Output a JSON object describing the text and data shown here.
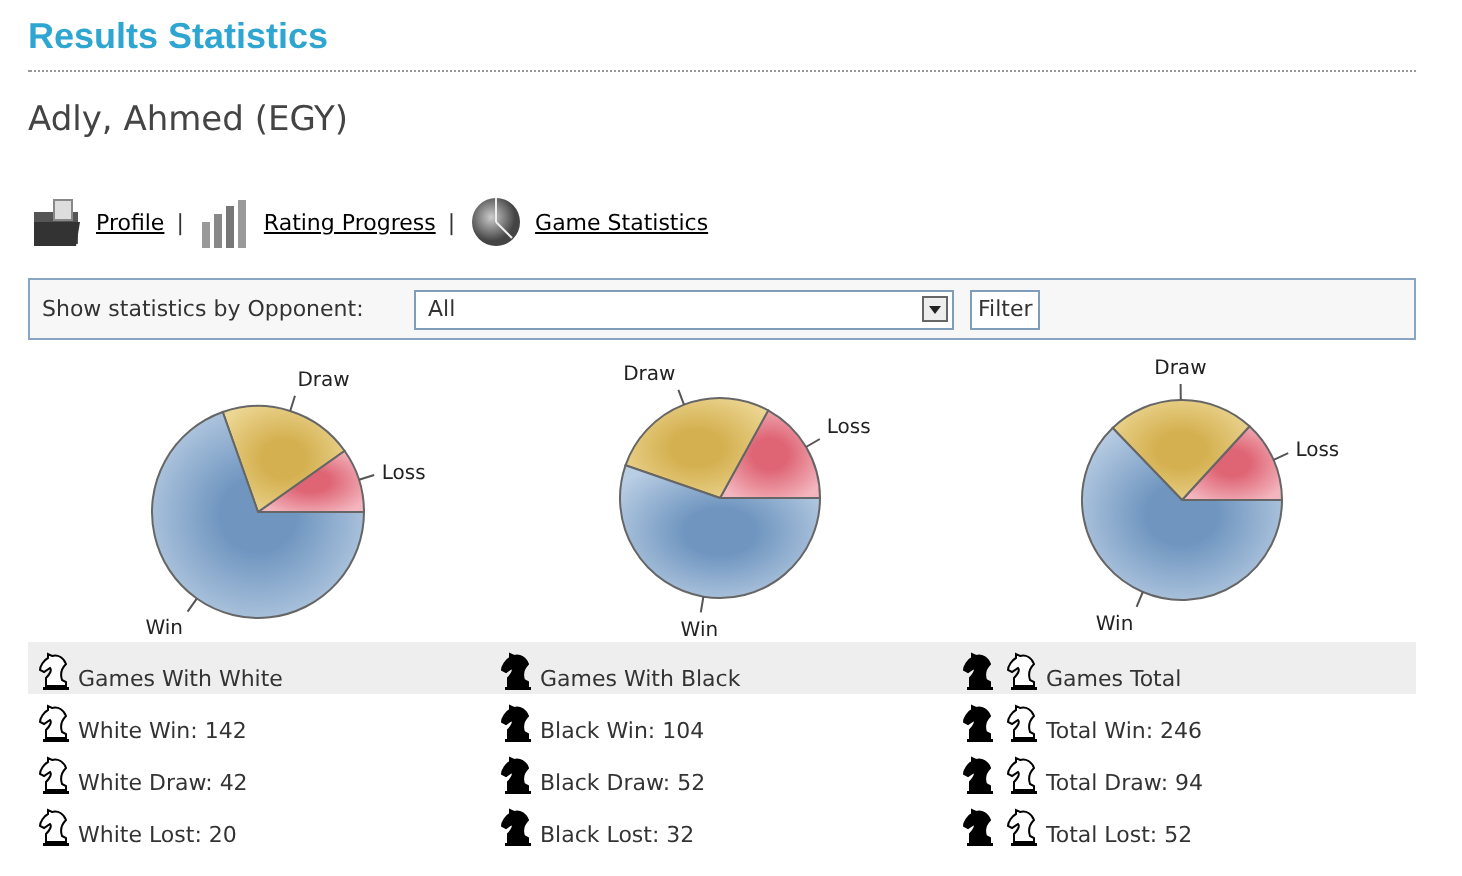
{
  "page_title": "Results Statistics",
  "player": "Adly, Ahmed (EGY)",
  "nav_links": [
    {
      "label": "Profile"
    },
    {
      "label": "Rating Progress"
    },
    {
      "label": "Game Statistics"
    }
  ],
  "nav_separators": [
    "|",
    "|"
  ],
  "filter": {
    "label": "Show statistics by Opponent:",
    "value": "All",
    "button": "Filter"
  },
  "charts": [
    {
      "chart_data": {
        "type": "pie",
        "categories": [
          "Win",
          "Draw",
          "Loss"
        ],
        "values": [
          69.6,
          20.6,
          9.8
        ]
      }
    },
    {
      "chart_data": {
        "type": "pie",
        "categories": [
          "Win",
          "Draw",
          "Loss"
        ],
        "values": [
          55.3,
          27.7,
          17.0
        ]
      }
    },
    {
      "chart_data": {
        "type": "pie",
        "categories": [
          "Win",
          "Draw",
          "Loss"
        ],
        "values": [
          62.8,
          24.0,
          13.2
        ]
      }
    }
  ],
  "table": {
    "columns": [
      "Games With White",
      "Games With Black",
      "Games Total"
    ],
    "rows": [
      [
        "White Win: 142",
        "Black Win: 104",
        "Total Win: 246"
      ],
      [
        "White Draw: 42",
        "Black Draw: 52",
        "Total Draw: 94"
      ],
      [
        "White Lost: 20",
        "Black Lost: 32",
        "Total Lost: 52"
      ]
    ]
  }
}
